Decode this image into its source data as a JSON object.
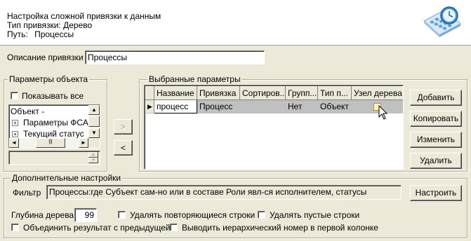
{
  "header": {
    "title": "Настройка сложной привязки к данным",
    "binding_type_label": "Тип привязки:",
    "binding_type_value": "Дерево",
    "path_label": "Путь:",
    "path_value": "Процессы"
  },
  "description": {
    "label": "Описание привязки",
    "value": "Процессы"
  },
  "object_params": {
    "group_title": "Параметры объекта",
    "show_all_label": "Показывать все",
    "tree": [
      {
        "label": "Объект -",
        "expander": "-"
      },
      {
        "label": "Параметры ФСА",
        "expander": "+"
      },
      {
        "label": "Текущий статус",
        "expander": "+"
      }
    ]
  },
  "arrows": {
    "add": ">",
    "remove": "<"
  },
  "selected_params": {
    "group_title": "Выбранные параметры",
    "columns": [
      "Название",
      "Привязка",
      "Сортиров...",
      "Групп...",
      "Тип п...",
      "Узел дерева"
    ],
    "rows": [
      {
        "name": "процесс",
        "binding": "Процесс",
        "sort": "",
        "group": "Нет",
        "type": "Объект",
        "tree_node": "checked"
      }
    ]
  },
  "buttons": {
    "add": "Добавить",
    "copy": "Копировать",
    "edit": "Изменить",
    "delete": "Удалить"
  },
  "additional": {
    "group_title": "Дополнительные настройки",
    "filter_label": "Фильтр",
    "filter_value": "Процессы:где Субъект сам-но или в составе Роли явл-ся исполнителем, статусы",
    "configure_button": "Настроить",
    "depth_label": "Глубина дерева",
    "depth_value": "99",
    "remove_duplicate_rows": "Удалять повторяющиеся строки",
    "remove_empty_rows": "Удалять пустые строки",
    "merge_with_previous": "Объединить результат с предыдущей",
    "hierarchical_number": "Выводить иерархический номер в первой колонке"
  },
  "colors": {
    "window_bg": "#ece9d8",
    "selected_row_bg": "#c0c0c0",
    "icon_blue": "#3a8fd6"
  },
  "icons": [
    "header-clock-calculator-icon",
    "row-indicator-arrow-icon",
    "tree-node-checkbox-icon",
    "mouse-cursor-icon"
  ]
}
